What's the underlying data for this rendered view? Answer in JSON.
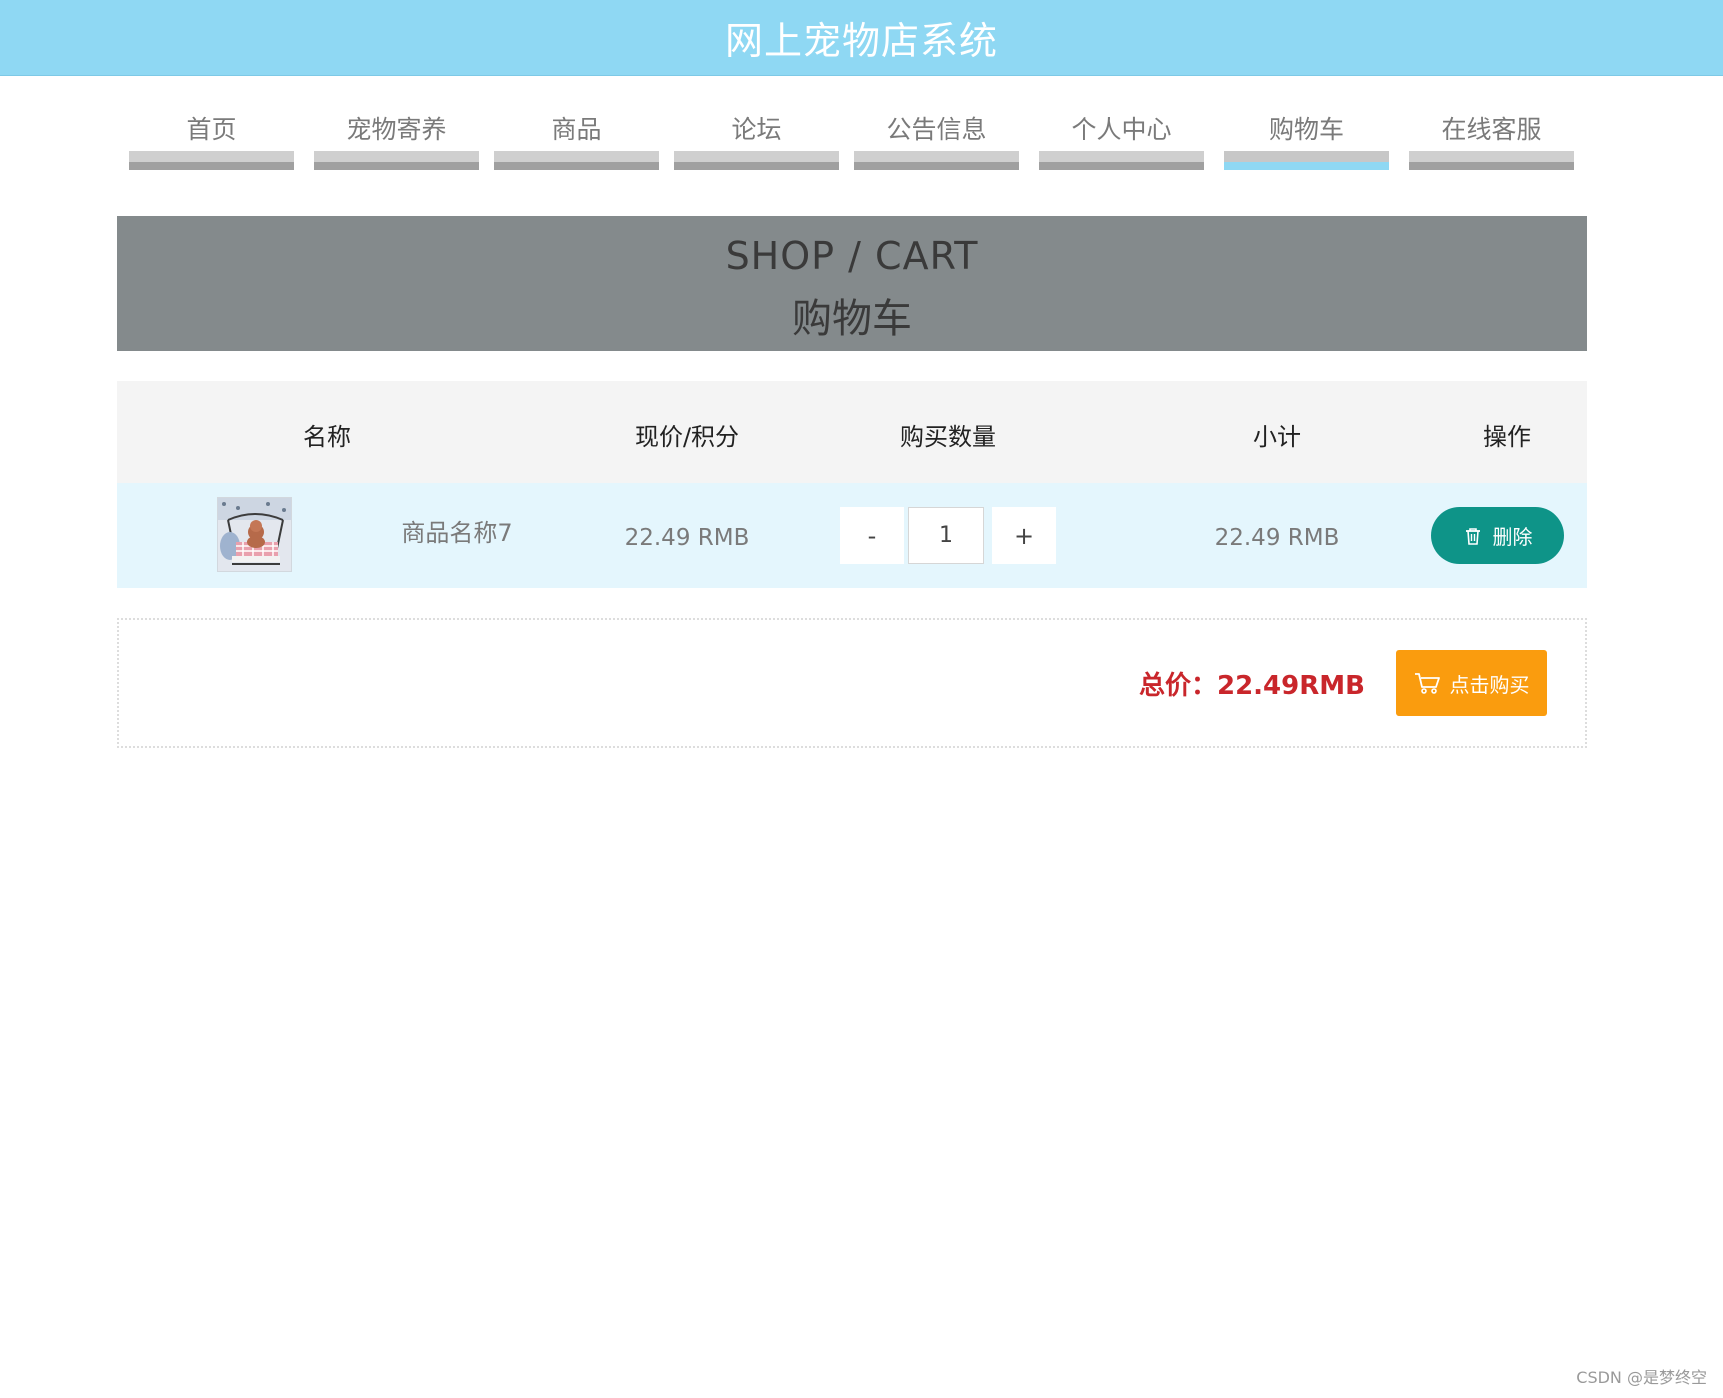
{
  "header": {
    "title": "网上宠物店系统",
    "background": "#8fd8f3"
  },
  "nav": {
    "items": [
      {
        "label": "首页",
        "active": false
      },
      {
        "label": "宠物寄养",
        "active": false
      },
      {
        "label": "商品",
        "active": false
      },
      {
        "label": "论坛",
        "active": false
      },
      {
        "label": "公告信息",
        "active": false
      },
      {
        "label": "个人中心",
        "active": false
      },
      {
        "label": "购物车",
        "active": true
      },
      {
        "label": "在线客服",
        "active": false
      }
    ],
    "active_color": "#8fd8f3"
  },
  "banner": {
    "title_en": "SHOP / CART",
    "title_cn": "购物车"
  },
  "cart": {
    "headers": {
      "name": "名称",
      "price": "现价/积分",
      "quantity": "购买数量",
      "subtotal": "小计",
      "actions": "操作"
    },
    "items": [
      {
        "name": "商品名称7",
        "price": "22.49 RMB",
        "quantity": "1",
        "subtotal": "22.49 RMB",
        "thumbnail_icon": "pet-product-thumbnail"
      }
    ],
    "stepper": {
      "minus": "-",
      "plus": "+"
    },
    "delete_label": "删除",
    "delete_icon": "trash-icon",
    "delete_color": "#0e9488"
  },
  "summary": {
    "total": "总价：22.49RMB",
    "total_color": "#c9262b",
    "buy_label": "点击购买",
    "buy_icon": "cart-icon",
    "buy_color": "#fa9c0e"
  },
  "watermark": "CSDN @是梦终空"
}
